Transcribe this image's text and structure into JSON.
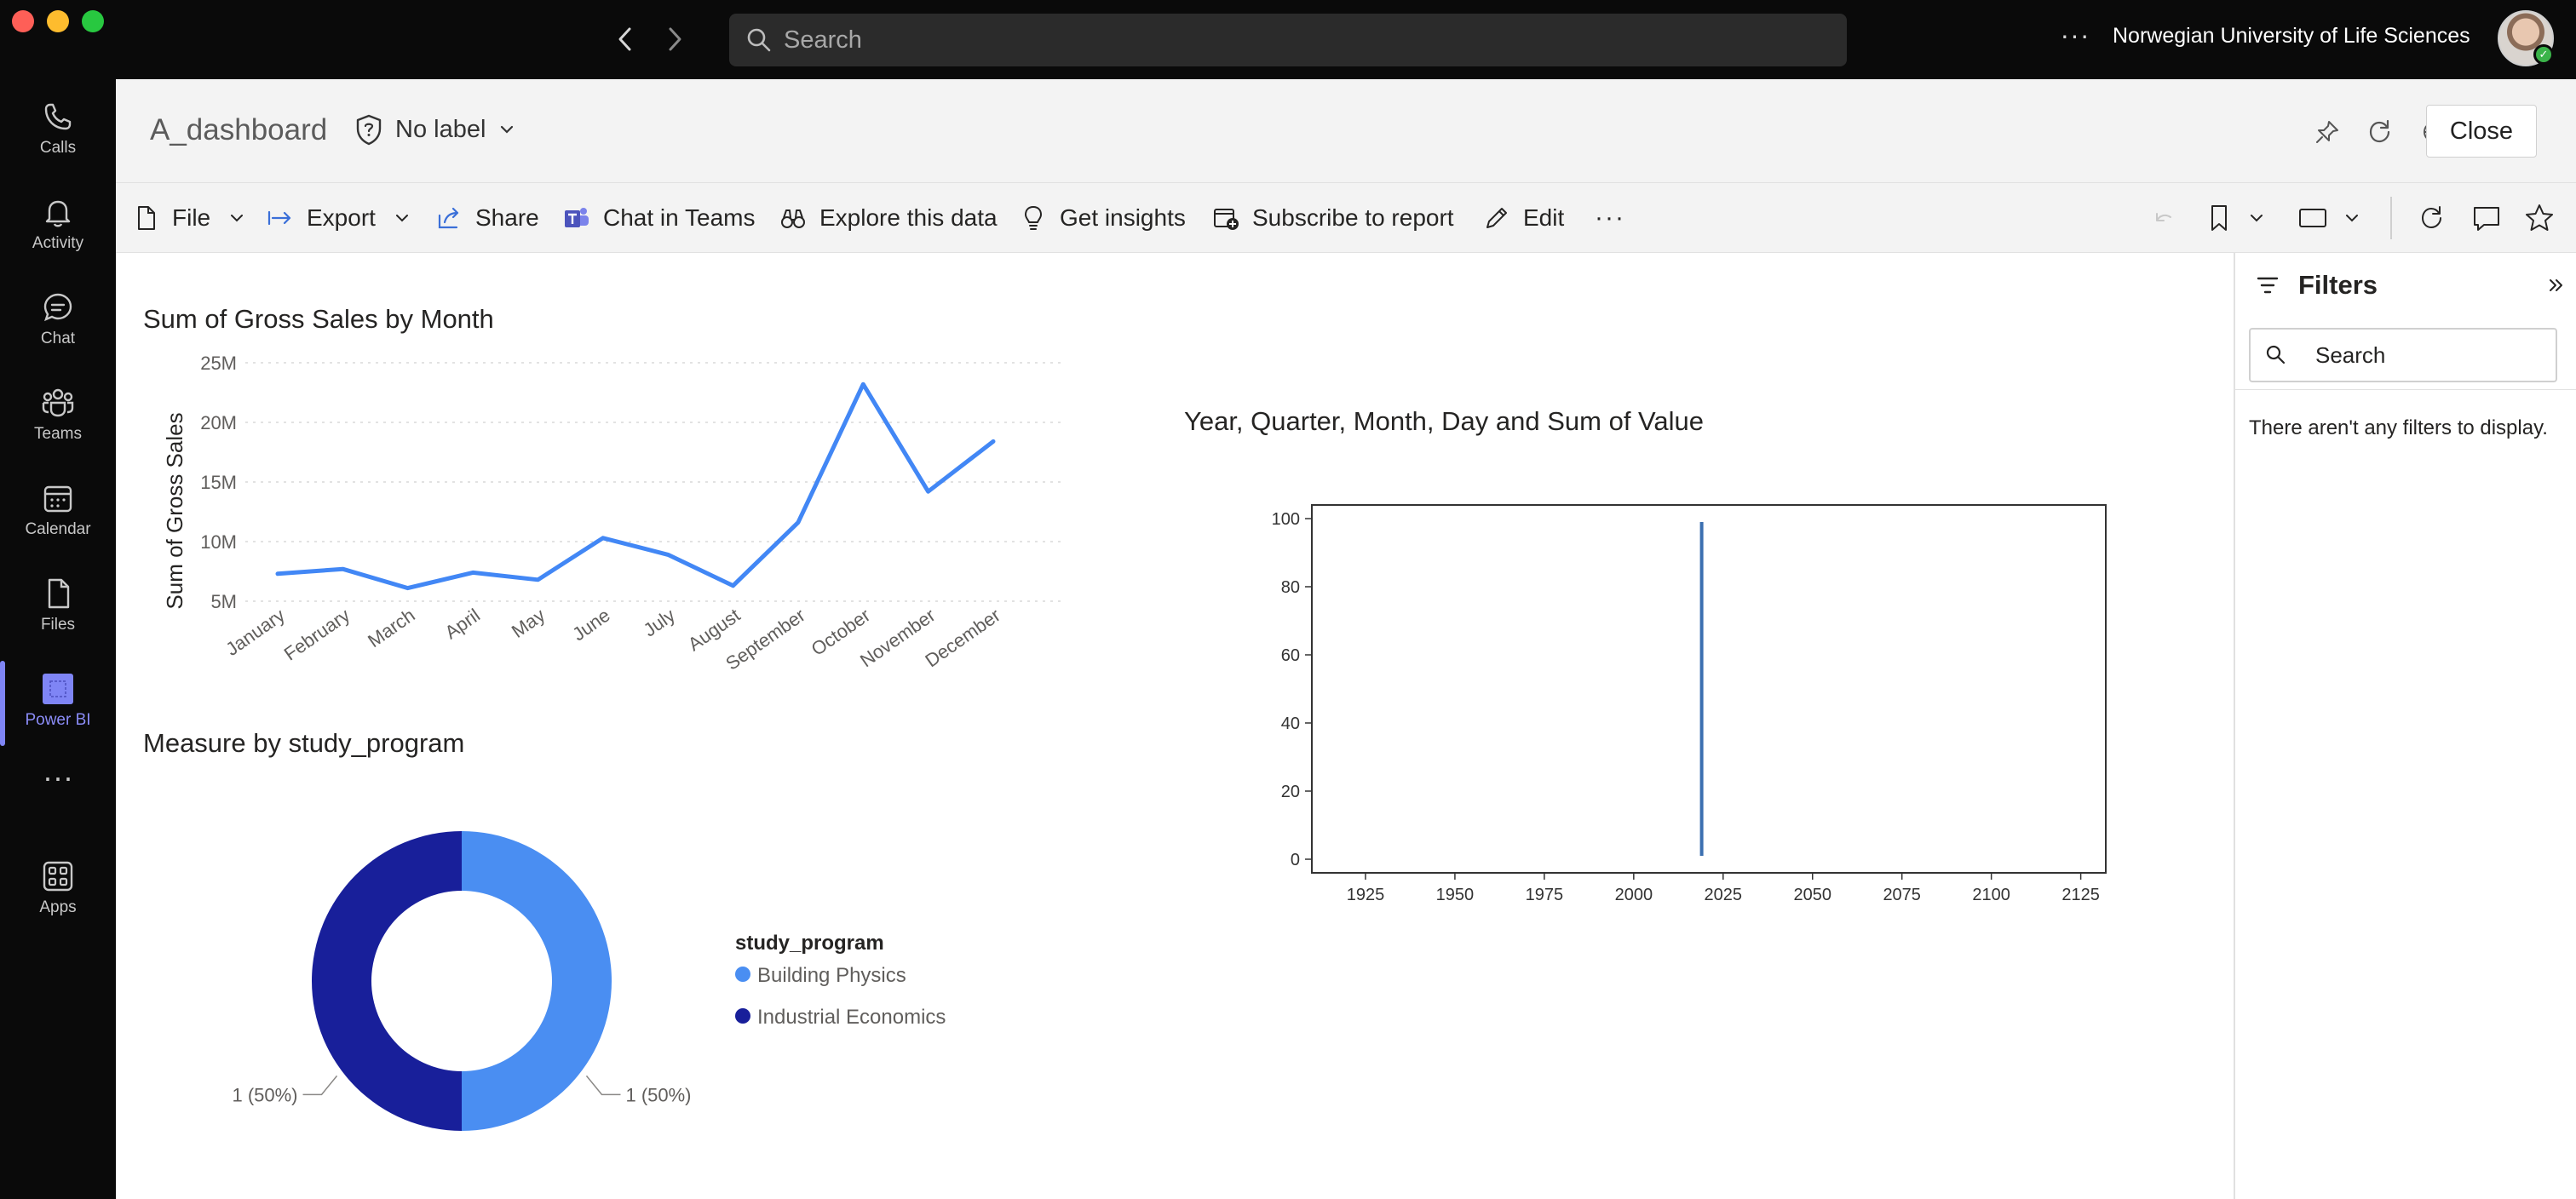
{
  "titlebar": {
    "search_placeholder": "Search",
    "organization": "Norwegian University of Life Sciences"
  },
  "rail": {
    "items": [
      {
        "label": "Calls",
        "icon": "phone-icon"
      },
      {
        "label": "Activity",
        "icon": "bell-icon"
      },
      {
        "label": "Chat",
        "icon": "chat-icon"
      },
      {
        "label": "Teams",
        "icon": "teams-icon"
      },
      {
        "label": "Calendar",
        "icon": "calendar-icon"
      },
      {
        "label": "Files",
        "icon": "file-icon"
      },
      {
        "label": "Power BI",
        "icon": "power-bi-icon",
        "active": true
      },
      {
        "label": "Apps",
        "icon": "apps-icon"
      }
    ],
    "accent_color": "#7f85f5"
  },
  "header": {
    "report_title": "A_dashboard",
    "sensitivity_label": "No label",
    "close_label": "Close"
  },
  "toolbar": {
    "file": "File",
    "export": "Export",
    "share": "Share",
    "chat_in_teams": "Chat in Teams",
    "explore": "Explore this data",
    "insights": "Get insights",
    "subscribe": "Subscribe to report",
    "edit": "Edit"
  },
  "filters": {
    "title": "Filters",
    "search_placeholder": "Search",
    "empty_message": "There aren't any filters to display."
  },
  "chart_data": [
    {
      "type": "line",
      "title": "Sum of Gross Sales by Month",
      "xlabel": "",
      "ylabel": "Sum of Gross Sales",
      "categories": [
        "January",
        "February",
        "March",
        "April",
        "May",
        "June",
        "July",
        "August",
        "September",
        "October",
        "November",
        "December"
      ],
      "values": [
        7.3,
        7.7,
        6.1,
        7.4,
        6.8,
        10.3,
        8.9,
        6.3,
        11.6,
        23.2,
        14.2,
        18.4
      ],
      "value_unit": "M",
      "yticks": [
        "5M",
        "10M",
        "15M",
        "20M",
        "25M"
      ],
      "ylim": [
        5,
        25
      ],
      "grid": true,
      "color": "#4287f5"
    },
    {
      "type": "pie",
      "title": "Measure by study_program",
      "legend_title": "study_program",
      "legend_placement": "right",
      "slices": [
        {
          "name": "Building Physics",
          "value": 1,
          "label": "1 (50%)",
          "color": "#4a8ef2"
        },
        {
          "name": "Industrial Economics",
          "value": 1,
          "label": "1 (50%)",
          "color": "#181f9a"
        }
      ]
    },
    {
      "type": "line",
      "title": "Year, Quarter, Month, Day and Sum of Value",
      "xlabel": "",
      "ylabel": "",
      "x": [
        2019,
        2019
      ],
      "y": [
        1,
        99
      ],
      "xticks": [
        "1925",
        "1950",
        "1975",
        "2000",
        "2025",
        "2050",
        "2075",
        "2100",
        "2125"
      ],
      "yticks": [
        "0",
        "20",
        "40",
        "60",
        "80",
        "100"
      ],
      "xlim": [
        1910,
        2132
      ],
      "ylim": [
        -4,
        104
      ],
      "grid": false,
      "color": "#3b6fb0"
    }
  ]
}
